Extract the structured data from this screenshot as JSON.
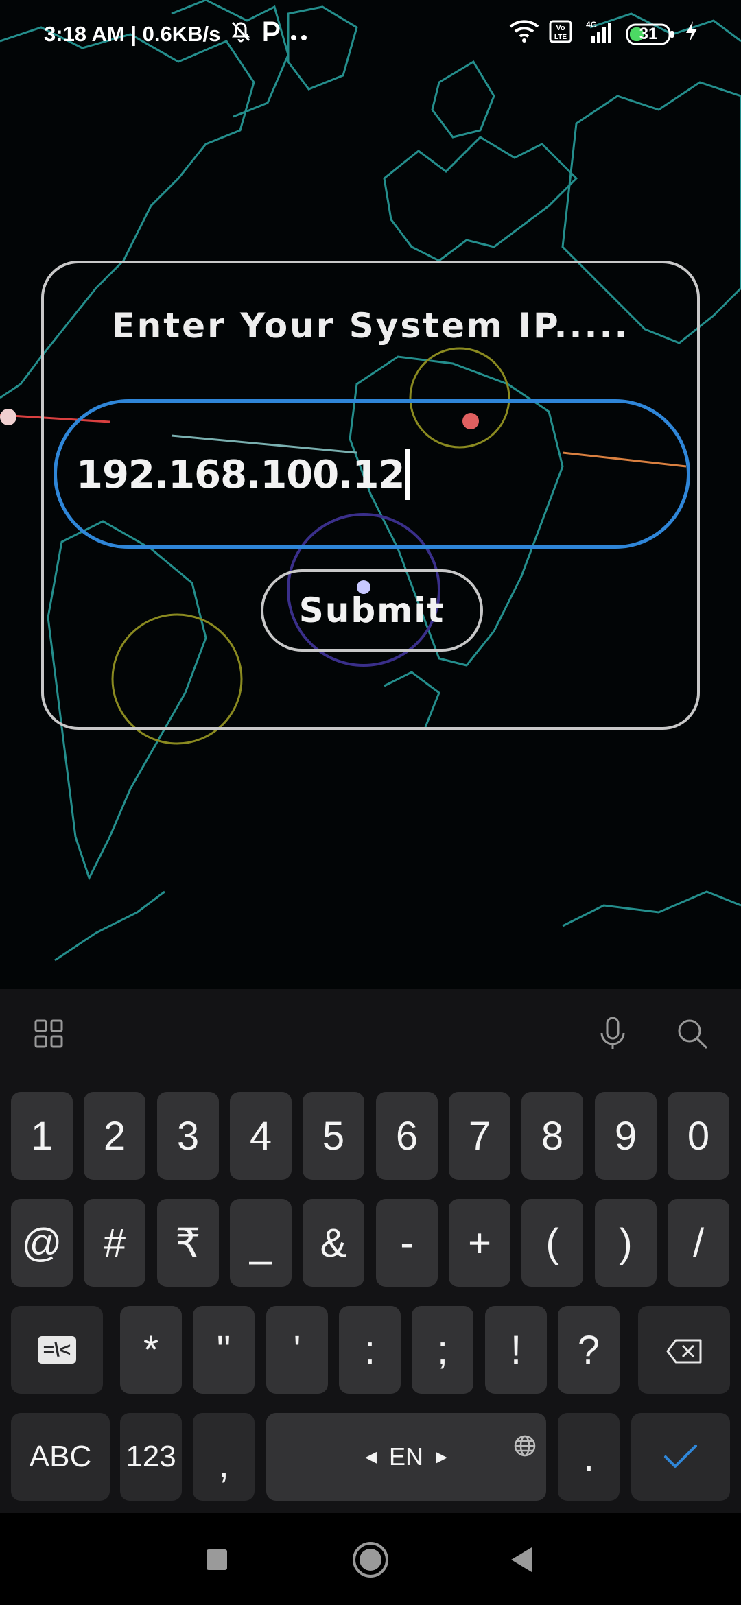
{
  "status_bar": {
    "time_speed": "3:18 AM | 0.6KB/s",
    "battery": "31",
    "icons": [
      "bell-off-icon",
      "parking-app-icon",
      "more-dots-icon",
      "wifi-icon",
      "volte-icon",
      "signal-4g-icon",
      "battery-icon",
      "charging-icon"
    ]
  },
  "form": {
    "title": "Enter Your System IP.....",
    "ip_value": "192.168.100.12",
    "submit_label": "Submit"
  },
  "keyboard": {
    "toolbar_icons": [
      "grid-menu-icon",
      "microphone-icon",
      "search-icon"
    ],
    "row1": [
      "1",
      "2",
      "3",
      "4",
      "5",
      "6",
      "7",
      "8",
      "9",
      "0"
    ],
    "row2": [
      "@",
      "#",
      "₹",
      "_",
      "&",
      "-",
      "+",
      "(",
      ")",
      "/"
    ],
    "row3": [
      "*",
      "\"",
      "'",
      ":",
      ";",
      "!",
      "?"
    ],
    "shift_label": "=\\<",
    "abc_label": "ABC",
    "num_label": "123",
    "comma_label": ",",
    "space_label": "EN",
    "period_label": ".",
    "accent_color": "#2f86d8"
  },
  "nav_bar": {
    "icons": [
      "recents-square-icon",
      "home-circle-icon",
      "back-triangle-icon"
    ]
  }
}
